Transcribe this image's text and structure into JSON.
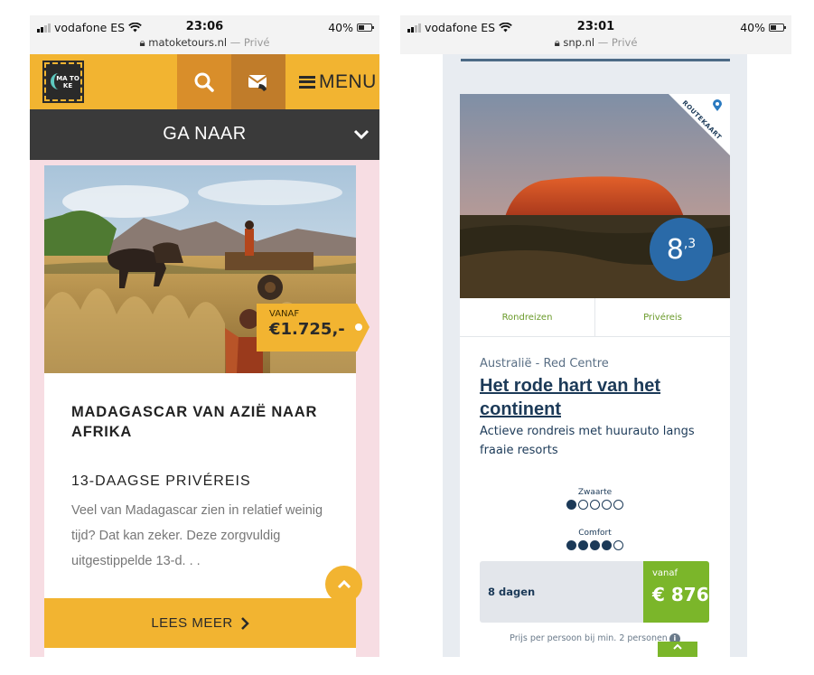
{
  "left": {
    "status": {
      "carrier": "vodafone ES",
      "time": "23:06",
      "battery": "40%",
      "url": "matoketours.nl",
      "private": "— Privé"
    },
    "nav": {
      "logo_text": "MA TO KE",
      "menu_label": "MENU",
      "brand_color": "#f2b431"
    },
    "goto_label": "GA NAAR",
    "card": {
      "price_prefix": "VANAF",
      "price": "€1.725,-",
      "title": "MADAGASCAR VAN AZIË NAAR AFRIKA",
      "subtitle": "13-DAAGSE PRIVÉREIS",
      "description": "Veel van Madagascar zien in relatief weinig tijd? Dat kan zeker. Deze zorgvuldig uitgestippelde 13-d. . .",
      "cta": "LEES MEER"
    }
  },
  "right": {
    "status": {
      "carrier": "vodafone ES",
      "time": "23:01",
      "battery": "40%",
      "url": "snp.nl",
      "private": "— Privé"
    },
    "card": {
      "route_label": "ROUTEKAART",
      "score_main": "8",
      "score_decimal": ",3",
      "tabs": [
        "Rondreizen",
        "Privéreis"
      ],
      "region": "Australië - Red Centre",
      "title": "Het rode hart van het continent",
      "description": "Actieve rondreis met huurauto langs fraaie resorts",
      "ratings": [
        {
          "label": "Zwaarte",
          "filled": 1,
          "total": 5
        },
        {
          "label": "Comfort",
          "filled": 4,
          "total": 5
        }
      ],
      "duration": "8 dagen",
      "price_prefix": "vanaf",
      "price": "€ 876",
      "note": "Prijs per persoon bij min. 2 personen",
      "accent_color": "#7bb62a",
      "primary_color": "#1c3a58"
    }
  }
}
